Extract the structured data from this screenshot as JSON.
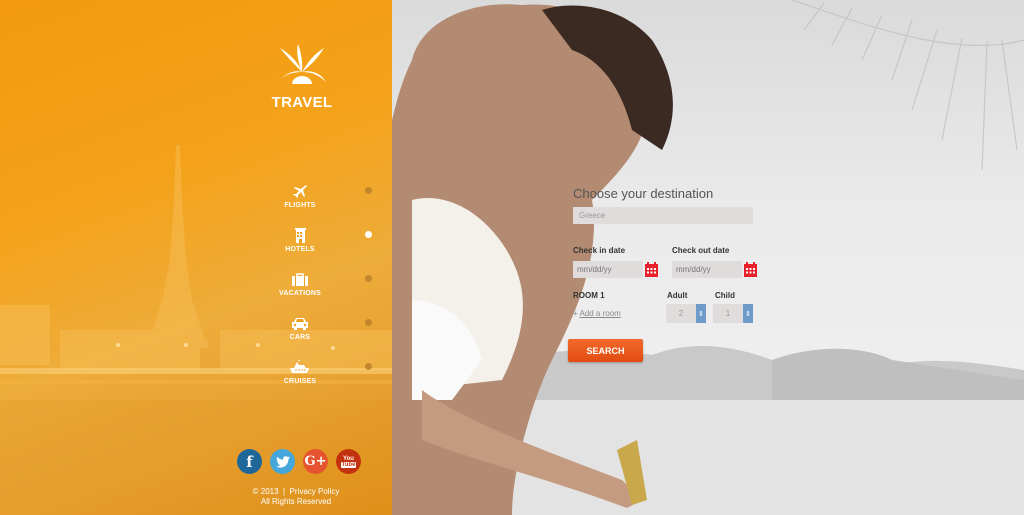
{
  "brand": {
    "name": "TRAVEL",
    "icon": "palm-tree-sun-icon"
  },
  "nav": {
    "items": [
      {
        "label": "FLIGHTS",
        "icon": "airplane-icon",
        "active": false
      },
      {
        "label": "HOTELS",
        "icon": "hotel-building-icon",
        "active": true
      },
      {
        "label": "VACATIONS",
        "icon": "suitcase-icon",
        "active": false
      },
      {
        "label": "CARS",
        "icon": "car-icon",
        "active": false
      },
      {
        "label": "CRUISES",
        "icon": "ship-icon",
        "active": false
      }
    ]
  },
  "social": [
    {
      "name": "facebook",
      "glyph": "f",
      "color": "#1f6699"
    },
    {
      "name": "twitter",
      "glyph": "twitter-bird",
      "color": "#45a6dc"
    },
    {
      "name": "google-plus",
      "glyph": "G+",
      "color": "#e5532f"
    },
    {
      "name": "youtube",
      "glyph": "You Tube",
      "color": "#c3320f"
    }
  ],
  "footer": {
    "copyright": "© 2013",
    "separator": "|",
    "privacy_link": "Privacy Policy",
    "rights": "All Rights Reserved"
  },
  "form": {
    "title": "Choose your destination",
    "destination_value": "Greece",
    "check_in_label": "Check in date",
    "check_out_label": "Check out date",
    "check_in_placeholder": "mm/dd/yy",
    "check_out_placeholder": "mm/dd/yy",
    "room_label": "ROOM 1",
    "adult_label": "Adult",
    "child_label": "Child",
    "add_room_prefix": "+",
    "add_room_link": "Add a room",
    "adult_value": "2",
    "child_value": "1",
    "search_label": "SEARCH"
  },
  "colors": {
    "sidebar_orange": "#f39a0e",
    "search_button": "#e8531a",
    "calendar_red": "#e8202a",
    "spinner_blue": "#6f9bc9"
  }
}
